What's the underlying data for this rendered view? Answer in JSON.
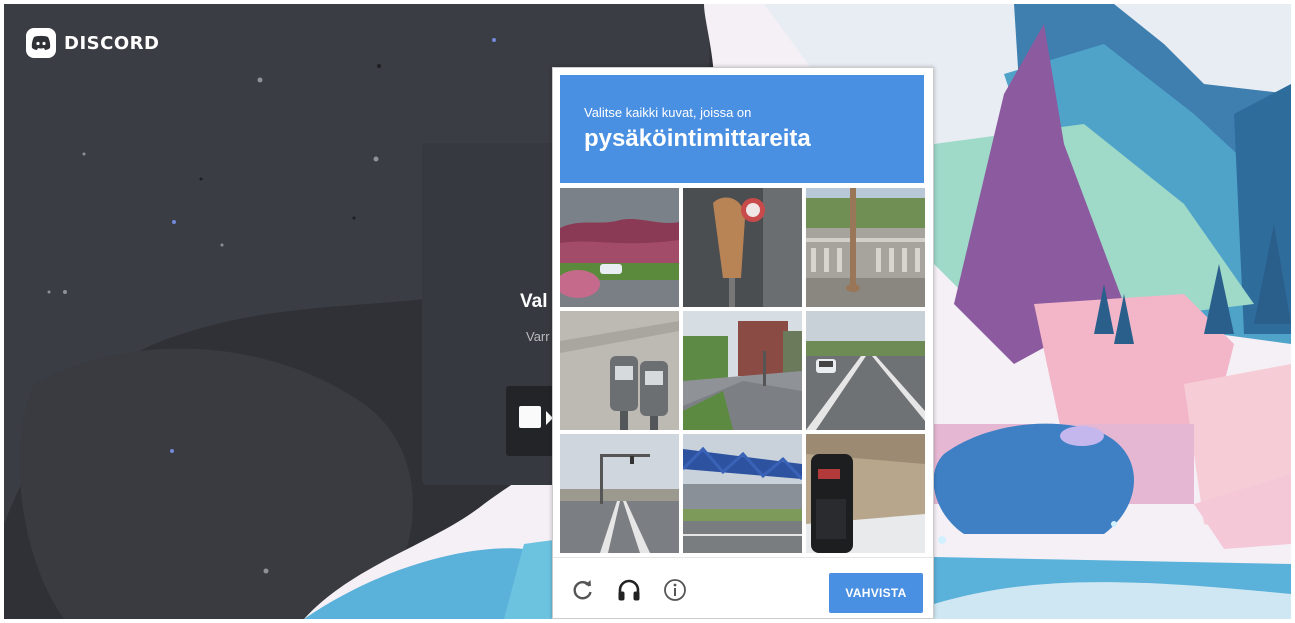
{
  "app": {
    "logo_text": "DISCORD"
  },
  "background_card": {
    "title": "Val",
    "subtitle": "Varr"
  },
  "captcha": {
    "instruction": "Valitse kaikki kuvat, joissa on",
    "target": "pysäköintimittareita",
    "verify_label": "VAHVISTA",
    "header_color": "#4a90e2",
    "tiles": [
      {
        "name": "tile-trees-street"
      },
      {
        "name": "tile-meter-closeup"
      },
      {
        "name": "tile-bridge-railing"
      },
      {
        "name": "tile-double-meters"
      },
      {
        "name": "tile-street-buildings"
      },
      {
        "name": "tile-highway-car"
      },
      {
        "name": "tile-intersection"
      },
      {
        "name": "tile-blue-bridge"
      },
      {
        "name": "tile-meter-dark"
      }
    ],
    "footer_icons": [
      "reload-icon",
      "audio-headphones-icon",
      "info-icon"
    ]
  }
}
